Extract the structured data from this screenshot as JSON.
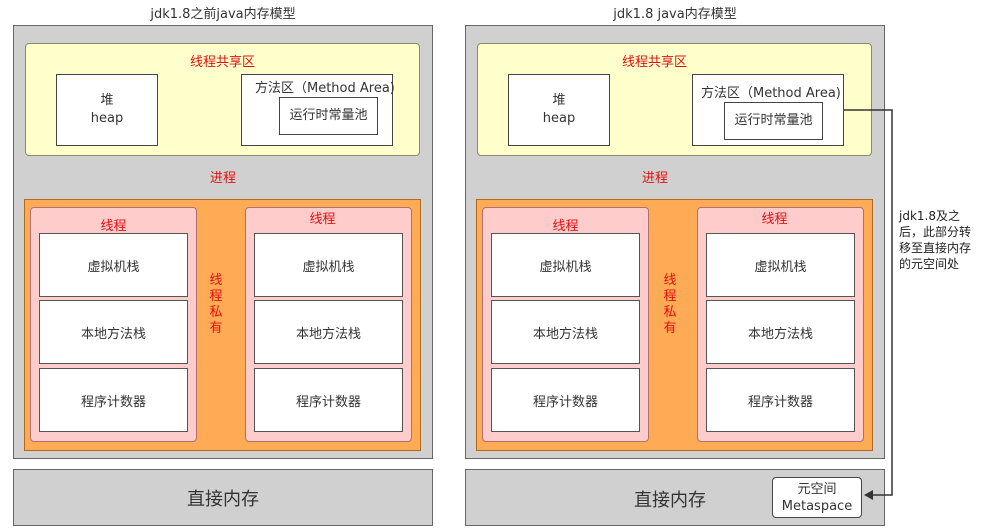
{
  "left": {
    "title": "jdk1.8之前java内存模型",
    "shared_title": "线程共享区",
    "heap_cn": "堆",
    "heap_en": "heap",
    "method_area": "方法区（Method Area)",
    "constant_pool": "运行时常量池",
    "process": "进程",
    "private_label": [
      "线",
      "程",
      "私",
      "有"
    ],
    "thread_label": "线程",
    "vm_stack": "虚拟机栈",
    "native_stack": "本地方法栈",
    "pc_counter": "程序计数器",
    "direct_memory": "直接内存"
  },
  "right": {
    "title": "jdk1.8 java内存模型",
    "shared_title": "线程共享区",
    "heap_cn": "堆",
    "heap_en": "heap",
    "method_area": "方法区（Method Area)",
    "constant_pool": "运行时常量池",
    "process": "进程",
    "private_label": [
      "线",
      "程",
      "私",
      "有"
    ],
    "thread_label": "线程",
    "vm_stack": "虚拟机栈",
    "native_stack": "本地方法栈",
    "pc_counter": "程序计数器",
    "direct_memory": "直接内存",
    "metaspace_cn": "元空间",
    "metaspace_en": "Metaspace"
  },
  "note": [
    "jdk1.8及之",
    "后，此部分转",
    "移至直接内存",
    "的元空间处"
  ],
  "colors": {
    "jvm_bg": "#d0d0d0",
    "shared_bg": "#ffffcc",
    "private_bg": "#ffaa55",
    "thread_bg": "#ffcccc",
    "label_red": "#e01010"
  }
}
